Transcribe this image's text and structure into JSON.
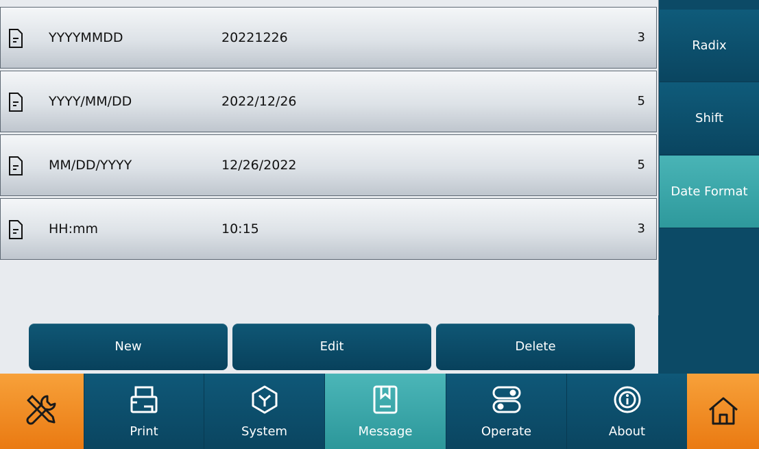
{
  "rows": [
    {
      "format": "YYYYMMDD",
      "value": "20221226",
      "length": "3"
    },
    {
      "format": "YYYY/MM/DD",
      "value": "2022/12/26",
      "length": "5"
    },
    {
      "format": "MM/DD/YYYY",
      "value": "12/26/2022",
      "length": "5"
    },
    {
      "format": "HH:mm",
      "value": "10:15",
      "length": "3"
    }
  ],
  "actions": {
    "new": "New",
    "edit": "Edit",
    "delete": "Delete"
  },
  "sidebar": {
    "items": [
      {
        "label": "Radix",
        "active": false
      },
      {
        "label": "Shift",
        "active": false
      },
      {
        "label": "Date Format",
        "active": true
      }
    ]
  },
  "nav": {
    "tabs": [
      {
        "label": "Print",
        "icon": "printer-icon"
      },
      {
        "label": "System",
        "icon": "hexagon-icon"
      },
      {
        "label": "Message",
        "icon": "bookmark-document-icon",
        "active": true
      },
      {
        "label": "Operate",
        "icon": "toggle-switches-icon"
      },
      {
        "label": "About",
        "icon": "info-icon"
      }
    ],
    "left_button_icon": "tools-icon",
    "right_button_icon": "home-icon"
  },
  "colors": {
    "panel": "#0c4a66",
    "active": "#3aa8aa",
    "accent": "#f08a1e",
    "row": "#dde2e7"
  }
}
